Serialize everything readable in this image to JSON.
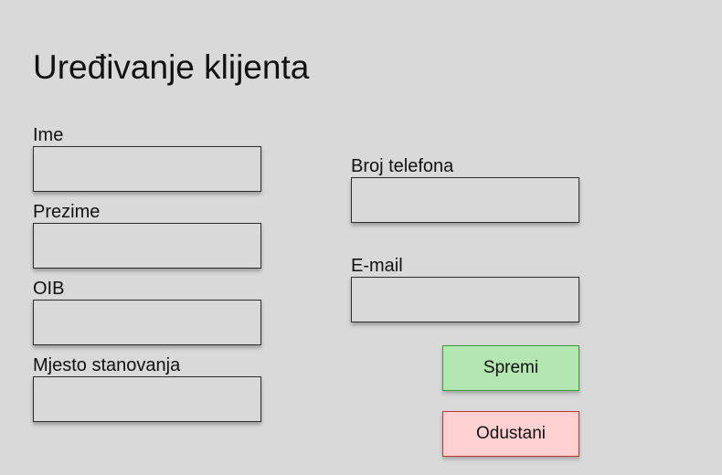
{
  "page": {
    "title": "Uređivanje klijenta"
  },
  "form": {
    "ime": {
      "label": "Ime",
      "value": "",
      "placeholder": ""
    },
    "prezime": {
      "label": "Prezime",
      "value": "",
      "placeholder": ""
    },
    "oib": {
      "label": "OIB",
      "value": "",
      "placeholder": ""
    },
    "mjesto": {
      "label": "Mjesto stanovanja",
      "value": "",
      "placeholder": ""
    },
    "telefon": {
      "label": "Broj telefona",
      "value": "",
      "placeholder": ""
    },
    "email": {
      "label": "E-mail",
      "value": "",
      "placeholder": ""
    }
  },
  "actions": {
    "save_label": "Spremi",
    "cancel_label": "Odustani"
  },
  "colors": {
    "background": "#d9d9d9",
    "save_bg": "#b3e6b0",
    "save_border": "#3a9a3a",
    "cancel_bg": "#ffd1d1",
    "cancel_border": "#b83838"
  }
}
